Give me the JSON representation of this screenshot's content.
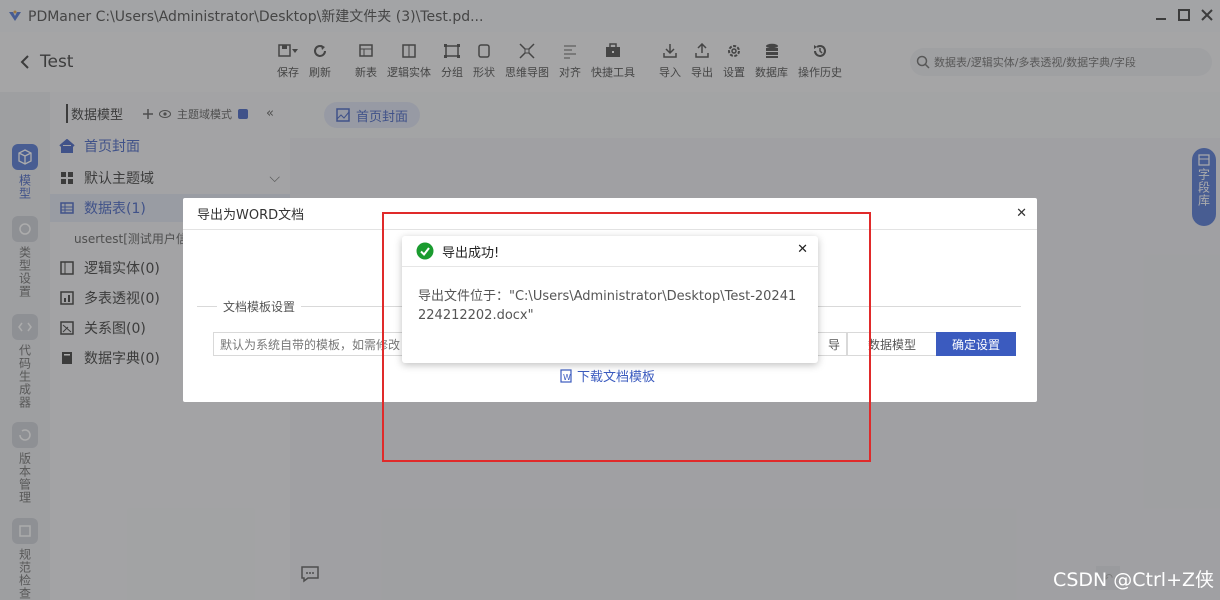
{
  "app": {
    "title": "PDManer  C:\\Users\\Administrator\\Desktop\\新建文件夹 (3)\\Test.pd...",
    "project": "Test"
  },
  "toolbar": {
    "items": [
      {
        "label": "保存",
        "icon": "save-icon"
      },
      {
        "label": "刷新",
        "icon": "refresh-icon"
      },
      {
        "label": "新表",
        "icon": "new-table-icon"
      },
      {
        "label": "逻辑实体",
        "icon": "logic-entity-icon"
      },
      {
        "label": "分组",
        "icon": "group-icon"
      },
      {
        "label": "形状",
        "icon": "shape-icon"
      },
      {
        "label": "思维导图",
        "icon": "mindmap-icon"
      },
      {
        "label": "对齐",
        "icon": "align-icon"
      },
      {
        "label": "快捷工具",
        "icon": "toolbox-icon"
      },
      {
        "label": "导入",
        "icon": "import-icon"
      },
      {
        "label": "导出",
        "icon": "export-icon"
      },
      {
        "label": "设置",
        "icon": "settings-icon"
      },
      {
        "label": "数据库",
        "icon": "database-icon"
      },
      {
        "label": "操作历史",
        "icon": "history-icon"
      }
    ]
  },
  "search": {
    "placeholder": "数据表/逻辑实体/多表透视/数据字典/字段"
  },
  "rail": [
    {
      "label": "模型",
      "icon": "cube-icon",
      "active": true
    },
    {
      "label": "类型设置",
      "icon": "type-icon"
    },
    {
      "label": "代码生成器",
      "icon": "code-icon"
    },
    {
      "label": "版本管理",
      "icon": "version-icon"
    },
    {
      "label": "规范检查",
      "icon": "check-icon"
    }
  ],
  "sidebar": {
    "header": "数据模型",
    "domain_mode": "主题域模式",
    "items": [
      {
        "label": "首页封面"
      },
      {
        "label": "默认主题域"
      },
      {
        "label": "数据表(1)"
      },
      {
        "label": "usertest[测试用户信"
      },
      {
        "label": "逻辑实体(0)"
      },
      {
        "label": "多表透视(0)"
      },
      {
        "label": "关系图(0)"
      },
      {
        "label": "数据字典(0)"
      }
    ]
  },
  "main": {
    "tab": "首页封面",
    "side_panel": "字段库"
  },
  "word_dialog": {
    "title": "导出为WORD文档",
    "legend": "文档模板设置",
    "template_placeholder": "默认为系统自带的模板，如需修改",
    "btn_partial": "导",
    "btn_data_model": "数据模型",
    "btn_confirm": "确定设置",
    "download": "下载文档模板"
  },
  "success_dialog": {
    "title": "导出成功!",
    "message": "导出文件位于：\"C:\\Users\\Administrator\\Desktop\\Test-20241224212202.docx\""
  },
  "watermark": "CSDN @Ctrl+Z侠",
  "colors": {
    "accent": "#3b5bbf",
    "success": "#1a9b2f",
    "highlight": "#e02a2a"
  }
}
